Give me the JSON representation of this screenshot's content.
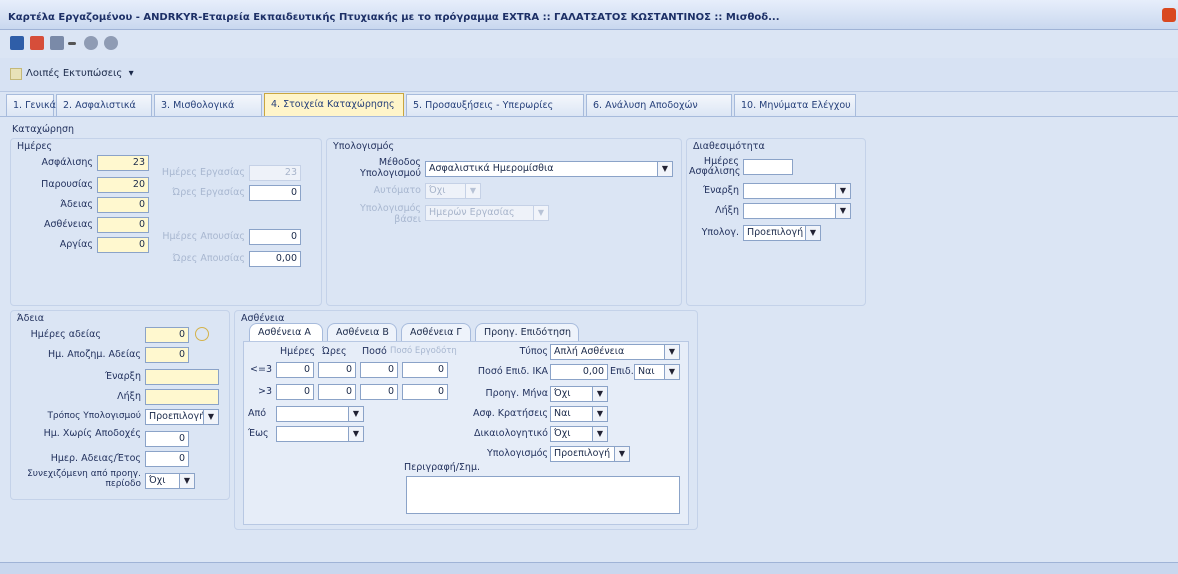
{
  "window": {
    "title": "Καρτέλα Εργαζομένου - ANDRKYR-Εταιρεία Εκπαιδευτικής Πτυχιακής με το πρόγραμμα EXTRA :: ΓΑΛΑΤΣΑΤΟΣ ΚΩΣΤΑΝΤΙΝΟΣ :: Μισθοδ..."
  },
  "toolbar": {
    "icons": [
      "save-icon",
      "delete-icon",
      "form-icon",
      "minus-icon",
      "back-icon",
      "forward-icon"
    ]
  },
  "subbar": {
    "actions_label": "Λοιπές Εκτυπώσεις"
  },
  "tabs": [
    {
      "label": "1. Γενικά"
    },
    {
      "label": "2. Ασφαλιστικά"
    },
    {
      "label": "3. Μισθολογικά"
    },
    {
      "label": "4. Στοιχεία Καταχώρησης"
    },
    {
      "label": "5. Προσαυξήσεις - Υπερωρίες"
    },
    {
      "label": "6. Ανάλυση Αποδοχών"
    },
    {
      "label": "10. Μηνύματα Ελέγχου"
    }
  ],
  "panel": {
    "title": "Καταχώρηση"
  },
  "days": {
    "title": "Ημέρες",
    "asfalisis": {
      "label": "Ασφάλισης",
      "value": "23"
    },
    "parousias": {
      "label": "Παρουσίας",
      "value": "20"
    },
    "adeias": {
      "label": "Άδειας",
      "value": "0"
    },
    "astheneias": {
      "label": "Ασθένειας",
      "value": "0"
    },
    "argias": {
      "label": "Αργίας",
      "value": "0"
    },
    "imeres_ergasias": {
      "label": "Ημέρες Εργασίας",
      "value": "23"
    },
    "ores_ergasias": {
      "label": "Ώρες Εργασίας",
      "value": "0"
    },
    "imeres_apousias": {
      "label": "Ημέρες Απουσίας",
      "value": "0"
    },
    "ores_apousias": {
      "label": "Ώρες Απουσίας",
      "value": "0,00"
    }
  },
  "calc": {
    "title": "Υπολογισμός",
    "method_label": "Μέθοδος Υπολογισμού",
    "method_value": "Ασφαλιστικά Ημερομίσθια",
    "autom_label": "Αυτόματο",
    "autom_value": "Όχι",
    "basis_label": "Υπολογισμός βάσει",
    "basis_value": "Ημερών Εργασίας"
  },
  "availability": {
    "title": "Διαθεσιμότητα",
    "days_label": "Ημέρες Ασφάλισης",
    "days_value": "",
    "start_label": "Έναρξη",
    "end_label": "Λήξη",
    "calc_label": "Υπολογ.",
    "calc_value": "Προεπιλογή"
  },
  "other": {
    "title": "Άδεια",
    "days_leave_label": "Ημέρες αδείας",
    "days_leave_value": "0",
    "allowance_label": "Ημ. Αποζημ. Αδείας",
    "allowance_value": "0",
    "start_label": "Έναρξη",
    "end_label": "Λήξη",
    "method_label": "Τρόπος Υπολογισμού",
    "method_value": "Προεπιλογή",
    "unpaid_label": "Ημ. Χωρίς Αποδοχές",
    "unpaid_value": "0",
    "yearly_label": "Ημερ. Αδειας/Έτος",
    "yearly_value": "0",
    "continuation_label": "Συνεχιζόμενη από προηγ. περίοδο",
    "continuation_value": "Όχι"
  },
  "sickness": {
    "title": "Ασθένεια",
    "tabs": [
      "Ασθένεια Α",
      "Ασθένεια Β",
      "Ασθένεια Γ",
      "Προηγ. Επιδότηση"
    ],
    "col_days": "Ημέρες",
    "col_hours": "Ώρες",
    "col_amount": "Ποσό",
    "col_amount2": "Ποσό Εργοδότη",
    "row1_label": "<=3",
    "row2_label": ">3",
    "r1": [
      "0",
      "0",
      "0",
      "0"
    ],
    "r2": [
      "0",
      "0",
      "0",
      "0"
    ],
    "from_label": "Από",
    "to_label": "Έως",
    "type_label": "Τύπος",
    "type_value": "Απλή Ασθένεια",
    "pct_label": "Ποσό Επιδ. ΙΚΑ",
    "pct_value": "0,00",
    "epid_label": "Επιδ.",
    "epid_value": "Ναι",
    "prev_label": "Προηγ. Μήνα",
    "prev_value": "Όχι",
    "aggr_label": "Ασφ. Κρατήσεις",
    "aggr_value": "Ναι",
    "dikaiologitiko_label": "Δικαιολογητικό",
    "dikaiologitiko_value": "Όχι",
    "calc_label": "Υπολογισμός",
    "calc_value": "Προεπιλογή",
    "notes_label": "Περιγραφή/Σημ.",
    "notes_value": ""
  },
  "statusbar": {
    "text": ""
  },
  "colors": {
    "accent": "#fff5c9",
    "panel": "#dbe5f4",
    "title": "#1c2f66"
  }
}
